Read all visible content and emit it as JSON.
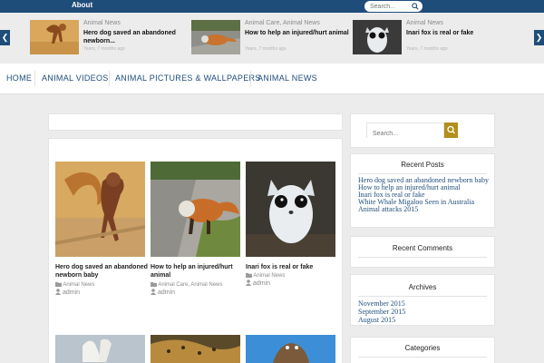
{
  "topbar": {
    "about": "About",
    "search_placeholder": "Search..."
  },
  "ticker": {
    "items": [
      {
        "category": "Animal News",
        "title": "Hero dog saved an abandoned newborn...",
        "date": "Years, 7 months ago"
      },
      {
        "category": "Animal Care, Animal News",
        "title": "How to help an injured/hurt animal",
        "date": "Years, 7 months ago"
      },
      {
        "category": "Animal News",
        "title": "Inari fox is real or fake",
        "date": "Years, 7 months ago"
      }
    ]
  },
  "nav": {
    "items": [
      "HOME",
      "ANIMAL VIDEOS",
      "ANIMAL PICTURES & WALLPAPERS",
      "ANIMAL NEWS"
    ]
  },
  "posts": [
    {
      "title": "Hero dog saved an abandoned newborn baby",
      "category": "Animal News",
      "author": "admin"
    },
    {
      "title": "How to help an injured/hurt animal",
      "category": "Animal Care, Animal News",
      "author": "admin"
    },
    {
      "title": "Inari fox is real or fake",
      "category": "Animal News",
      "author": "admin"
    }
  ],
  "sidebar": {
    "search_placeholder": "Search...",
    "recent_posts": {
      "title": "Recent Posts",
      "items": [
        "Hero dog saved an abandoned newborn baby",
        "How to help an injured/hurt animal",
        "Inari fox is real or fake",
        "White Whale Migaloo Seen in Australia",
        "Animal attacks 2015"
      ]
    },
    "recent_comments": {
      "title": "Recent Comments"
    },
    "archives": {
      "title": "Archives",
      "items": [
        "November 2015",
        "September 2015",
        "August 2015"
      ]
    },
    "categories": {
      "title": "Categories"
    }
  },
  "colors": {
    "brand_blue": "#1f4d7a",
    "search_button": "#b38f1b"
  }
}
